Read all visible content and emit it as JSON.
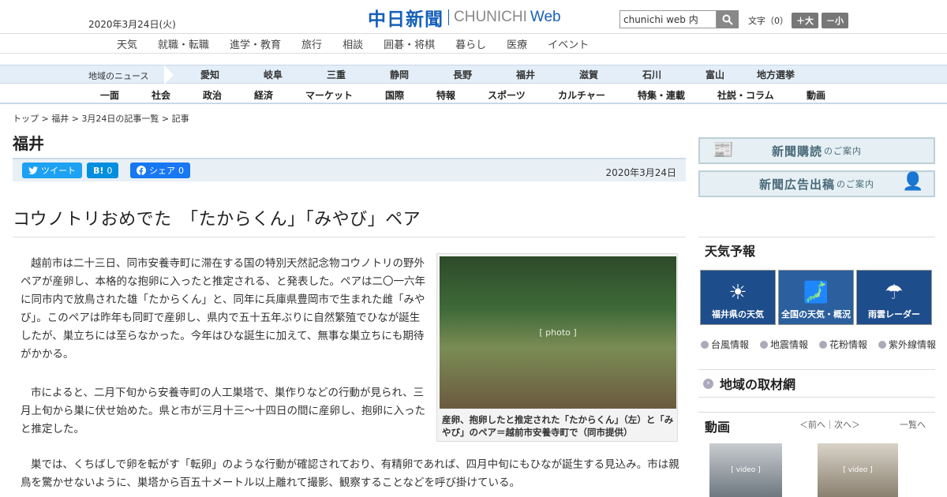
{
  "header": {
    "date": "2020年3月24日(火)",
    "logo_jp": "中日新聞",
    "logo_en1": "CHUNICHI",
    "logo_en2": "Web",
    "search_value": "chunichi web 内",
    "font_label": "文字（0）",
    "font_bigger": "＋大",
    "font_smaller": "－小"
  },
  "top_nav": [
    "天気",
    "就職・転職",
    "進学・教育",
    "旅行",
    "相談",
    "囲碁・将棋",
    "暮らし",
    "医療",
    "イベント"
  ],
  "region_nav": {
    "label": "地域のニュース",
    "items": [
      "愛知",
      "岐阜",
      "三重",
      "静岡",
      "長野",
      "福井",
      "滋賀",
      "石川",
      "富山",
      "地方選挙"
    ]
  },
  "category_nav": [
    "一面",
    "社会",
    "政治",
    "経済",
    "マーケット",
    "国際",
    "特報",
    "スポーツ",
    "カルチャー",
    "特集・連載",
    "社説・コラム",
    "動画"
  ],
  "breadcrumb": "トップ > 福井 > 3月24日の記事一覧 > 記事",
  "section_title": "福井",
  "share": {
    "tweet": "ツイート",
    "hatena_icon": "B!",
    "hatena_count": "0",
    "facebook": "シェア",
    "facebook_count": "0",
    "date": "2020年3月24日"
  },
  "article": {
    "headline": "コウノトリおめでた　「たからくん」「みやび」ペア",
    "p1": "越前市は二十三日、同市安養寺町に滞在する国の特別天然記念物コウノトリの野外ペアが産卵し、本格的な抱卵に入ったと推定される、と発表した。ペアは二〇一六年に同市内で放鳥された雄「たからくん」と、同年に兵庫県豊岡市で生まれた雌「みやび」。このペアは昨年も同町で産卵し、県内で五十五年ぶりに自然繁殖でひなが誕生したが、巣立ちには至らなかった。今年はひな誕生に加えて、無事な巣立ちにも期待がかかる。",
    "p2": "市によると、二月下旬から安養寺町の人工巣塔で、巣作りなどの行動が見られ、三月上旬から巣に伏せ始めた。県と市が三月十三～十四日の間に産卵し、抱卵に入ったと推定した。",
    "p3": "巣では、くちばしで卵を転がす「転卵」のような行動が確認されており、有精卵であれば、四月中旬にもひなが誕生する見込み。市は親鳥を驚かせないように、巣塔から百五十メートル以上離れて撮影、観察することなどを呼び掛けている。",
    "photo_caption": "産卵、抱卵したと推定された「たからくん」（左）と「みやび」のペア＝越前市安養寺町で（同市提供）"
  },
  "sidebar": {
    "banner1_main": "新聞購読",
    "banner1_sub": "のご案内",
    "banner2_main": "新聞広告出稿",
    "banner2_sub": "のご案内",
    "weather_title": "天気予報",
    "weather_tiles": [
      "福井県の天気",
      "全国の天気・概況",
      "雨雲レーダー"
    ],
    "weather_links": [
      "台風情報",
      "地震情報",
      "花粉情報",
      "紫外線情報"
    ],
    "network_title": "地域の取材網",
    "video_title": "動画",
    "video_prevnext": "＜前へ｜次へ＞",
    "video_all": "一覧へ"
  }
}
